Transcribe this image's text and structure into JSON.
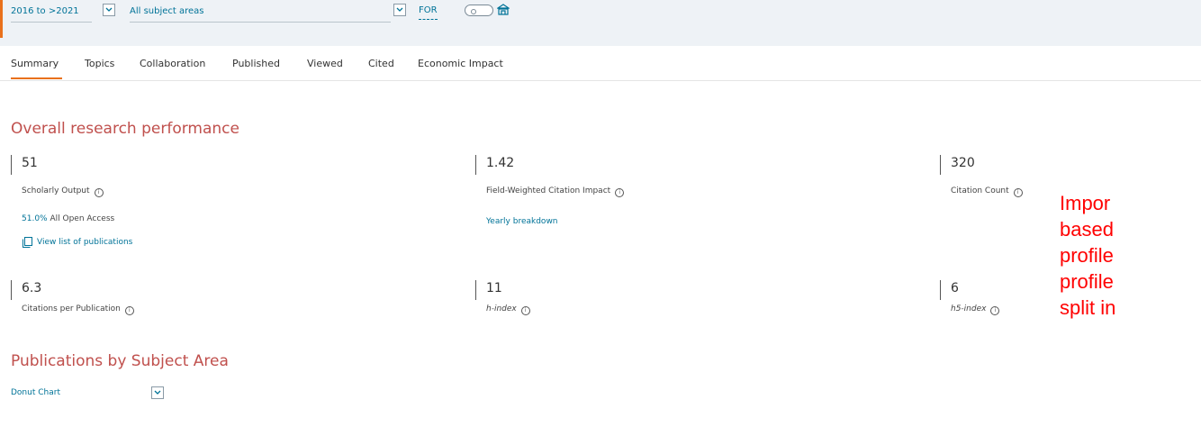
{
  "filters": {
    "date_range": "2016 to >2021",
    "subject_area": "All subject areas",
    "classification_link": "FOR"
  },
  "tabs": [
    {
      "label": "Summary",
      "active": true
    },
    {
      "label": "Topics"
    },
    {
      "label": "Collaboration"
    },
    {
      "label": "Published"
    },
    {
      "label": "Viewed"
    },
    {
      "label": "Cited"
    },
    {
      "label": "Economic Impact"
    }
  ],
  "overall": {
    "title": "Overall research performance",
    "scholarly_output": {
      "value": "51",
      "label": "Scholarly Output"
    },
    "open_access_percent": "51.0%",
    "open_access_label": "All Open Access",
    "view_list_link": "View list of publications",
    "fwci": {
      "value": "1.42",
      "label": "Field-Weighted Citation Impact"
    },
    "yearly_breakdown_link": "Yearly breakdown",
    "citation_count": {
      "value": "320",
      "label": "Citation Count"
    },
    "citations_per_publication": {
      "value": "6.3",
      "label": "Citations per Publication"
    },
    "h_index": {
      "value": "11",
      "label": "h-index"
    },
    "h5_index": {
      "value": "6",
      "label": "h5-index"
    }
  },
  "subject": {
    "title": "Publications by Subject Area",
    "chart_type_select": "Donut Chart"
  },
  "annotation": {
    "lines": [
      "Impor",
      "based",
      "profile",
      "profile",
      "split in"
    ]
  },
  "colors": {
    "accent": "#e9711c",
    "link": "#007398",
    "heading": "#c0504d",
    "annotation": "#ff0000"
  }
}
